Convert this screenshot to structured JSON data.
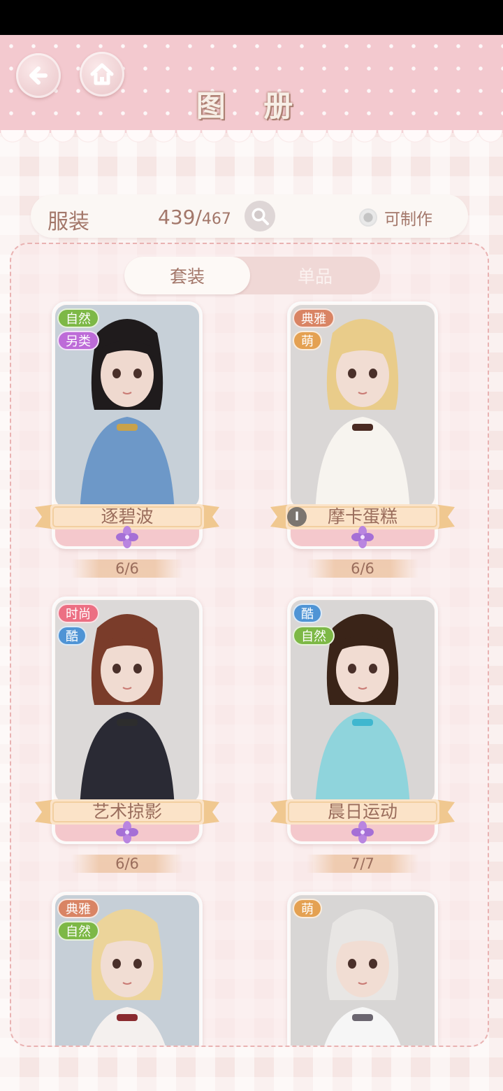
{
  "header": {
    "title": "图 册",
    "back_icon": "back-arrow-icon",
    "home_icon": "home-icon"
  },
  "infobar": {
    "category": "服装",
    "collected": "439",
    "total": "467",
    "search_icon": "magnifier-icon",
    "craftable_label": "可制作",
    "craftable_checked": false
  },
  "tabs": {
    "set": "套装",
    "single": "单品",
    "active": "套装"
  },
  "tag_colors": {
    "自然": "#7db846",
    "另类": "#bd6bd8",
    "典雅": "#d98464",
    "萌": "#e4a152",
    "时尚": "#ec6f83",
    "酷": "#4f94d5"
  },
  "outfits": [
    {
      "name": "逐碧波",
      "tags": [
        "自然",
        "另类"
      ],
      "progress": "6/6",
      "info_icon": false,
      "info_label": ""
    },
    {
      "name": "摩卡蛋糕",
      "tags": [
        "典雅",
        "萌"
      ],
      "progress": "6/6",
      "info_icon": true,
      "info_label": "I"
    },
    {
      "name": "艺术掠影",
      "tags": [
        "时尚",
        "酷"
      ],
      "progress": "6/6",
      "info_icon": false,
      "info_label": ""
    },
    {
      "name": "晨日运动",
      "tags": [
        "酷",
        "自然"
      ],
      "progress": "7/7",
      "info_icon": false,
      "info_label": ""
    },
    {
      "name": "",
      "tags": [
        "典雅",
        "自然"
      ],
      "progress": "",
      "info_icon": false,
      "info_label": ""
    },
    {
      "name": "",
      "tags": [
        "萌"
      ],
      "progress": "",
      "info_icon": false,
      "info_label": ""
    }
  ]
}
